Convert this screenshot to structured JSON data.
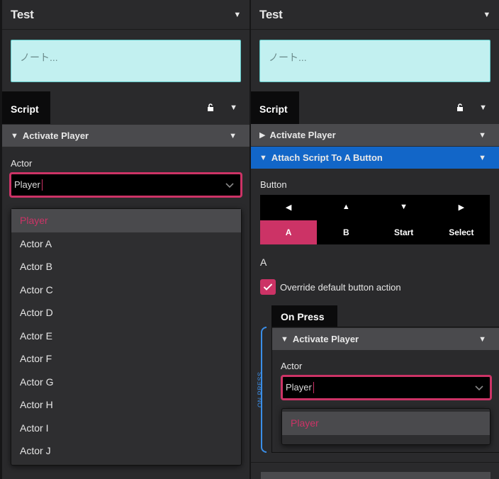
{
  "left": {
    "title": "Test",
    "note_placeholder": "ノート...",
    "script_tab": "Script",
    "section": "Activate Player",
    "actor_label": "Actor",
    "actor_value": "Player",
    "options": [
      "Player",
      "Actor A",
      "Actor B",
      "Actor C",
      "Actor D",
      "Actor E",
      "Actor F",
      "Actor G",
      "Actor H",
      "Actor I",
      "Actor J"
    ]
  },
  "right": {
    "title": "Test",
    "note_placeholder": "ノート...",
    "script_tab": "Script",
    "section1": "Activate Player",
    "section2": "Attach Script To A Button",
    "button_label": "Button",
    "buttons": [
      "A",
      "B",
      "Start",
      "Select"
    ],
    "selected_button": "A",
    "override_label": "Override default button action",
    "on_press_tab": "On Press",
    "on_press_vertical": "ON PRESS",
    "sub_section": "Activate Player",
    "actor_label": "Actor",
    "actor_value": "Player",
    "options": [
      "Player"
    ]
  },
  "colors": {
    "accent": "#cc3366",
    "blue": "#1266c8",
    "note_bg": "#c2f0f0",
    "panel_bg": "#2a2a2c"
  },
  "icons": [
    "triangle-down-icon",
    "triangle-right-icon",
    "lock-icon",
    "chevron-down-icon",
    "arrow-left-icon",
    "arrow-up-icon",
    "arrow-down-icon",
    "arrow-right-icon",
    "checkmark-icon"
  ]
}
